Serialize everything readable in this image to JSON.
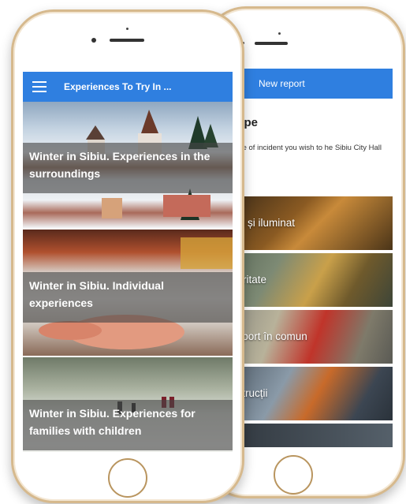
{
  "front_phone": {
    "app_bar": {
      "title": "Experiences To Try In ..."
    },
    "articles": [
      {
        "title": "Winter in Sibiu. Experiences in the surroundings"
      },
      {
        "title": "Winter in Sibiu. Individual experiences"
      },
      {
        "title": "Winter in Sibiu. Experiences for families with children"
      }
    ]
  },
  "back_phone": {
    "app_bar": {
      "title": "New report"
    },
    "incident": {
      "title": "t type",
      "description": "e type of incident you wish to he Sibiu City Hall"
    },
    "categories": [
      {
        "label": "ăzi și iluminat"
      },
      {
        "label": "ubritate"
      },
      {
        "label": "nsport în comun"
      },
      {
        "label": "nstrucții"
      }
    ]
  },
  "colors": {
    "app_bar": "#2f7fe0",
    "phone_frame": "#d6b98d"
  }
}
